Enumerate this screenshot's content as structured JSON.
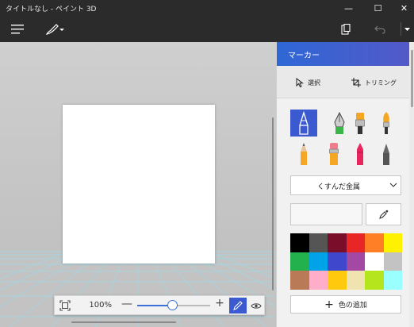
{
  "window": {
    "title": "タイトルなし - ペイント 3D",
    "minimize": "—",
    "maximize": "☐",
    "close": "✕"
  },
  "toolbar": {
    "menu_icon": "hamburger-menu-icon",
    "brushes_icon": "brush-icon",
    "paste_icon": "clipboard-icon",
    "undo_icon": "undo-icon"
  },
  "canvas": {
    "background": "#ffffff"
  },
  "zoom": {
    "percent_label": "100%",
    "minus_label": "—",
    "plus_label": "+",
    "slider_level": 0.48
  },
  "panel": {
    "title": "マーカー",
    "select_label": "選択",
    "crop_label": "トリミング",
    "material_value": "くすんだ金属",
    "add_color_label": "色の追加",
    "tools": [
      {
        "name": "marker",
        "selected": true
      },
      {
        "name": "calligraphy-pen",
        "selected": false
      },
      {
        "name": "oil-brush",
        "selected": false
      },
      {
        "name": "watercolor",
        "selected": false
      },
      {
        "name": "pencil",
        "selected": false
      },
      {
        "name": "eraser",
        "selected": false
      },
      {
        "name": "crayon",
        "selected": false
      },
      {
        "name": "pixel-pen",
        "selected": false
      }
    ],
    "palette": [
      "#000000",
      "#555555",
      "#7a0d2a",
      "#e82626",
      "#ff7f27",
      "#fff200",
      "#22b14c",
      "#00a2e8",
      "#3f48cc",
      "#a349a4",
      "#ffffff",
      "#c3c3c3",
      "#b97a57",
      "#ffaec9",
      "#ffc90e",
      "#efe4b0",
      "#b5e61d",
      "#99ffff"
    ]
  },
  "colors": {
    "accent": "#3b5ad0",
    "header_start": "#2f67d6",
    "header_end": "#5359c8",
    "chrome": "#2b2b2b"
  }
}
